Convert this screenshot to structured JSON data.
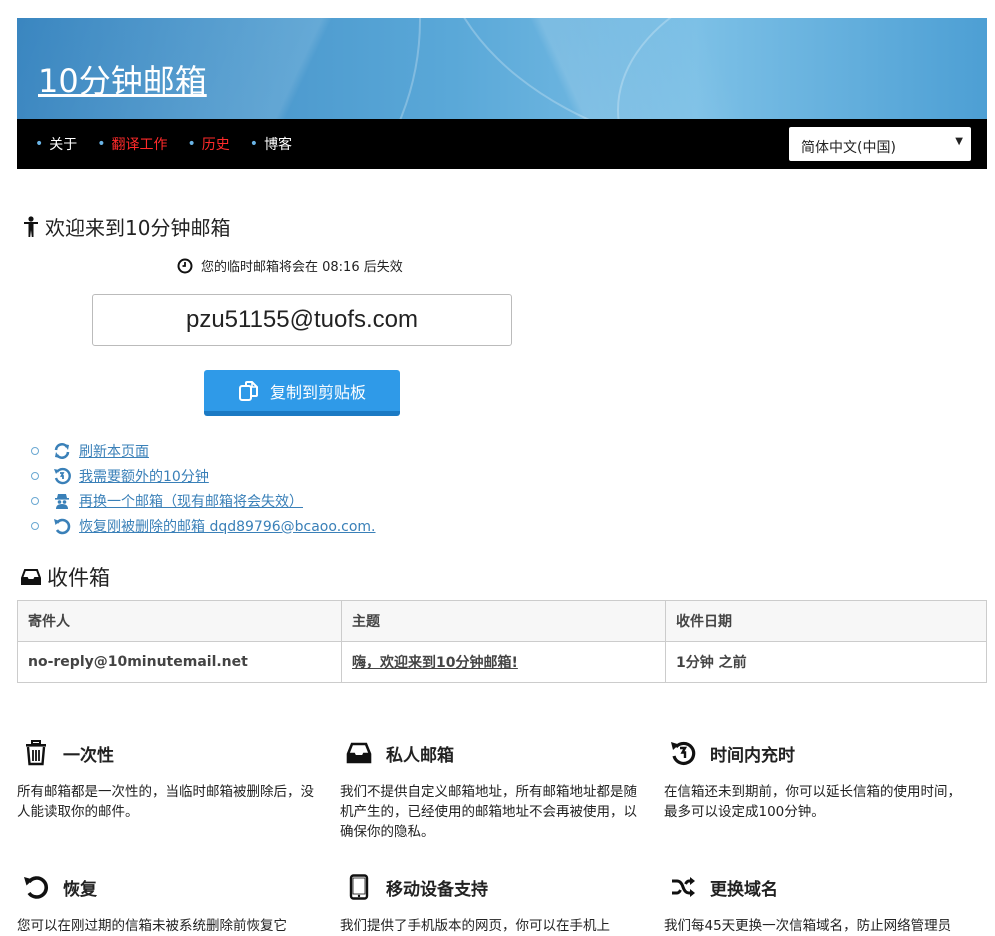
{
  "banner": {
    "title": "10分钟邮箱"
  },
  "nav": {
    "items": [
      {
        "label": "关于",
        "color": "#ffffff"
      },
      {
        "label": "翻译工作",
        "color": "#ff2a2a"
      },
      {
        "label": "历史",
        "color": "#ff2a2a"
      },
      {
        "label": "博客",
        "color": "#ffffff"
      }
    ],
    "language": "简体中文(中国)"
  },
  "welcome": "欢迎来到10分钟邮箱",
  "expire_text": "您的临时邮箱将会在 08:16 后失效",
  "email": "pzu51155@tuofs.com",
  "copy_button": "复制到剪贴板",
  "actions": [
    {
      "icon": "refresh-icon",
      "label": "刷新本页面"
    },
    {
      "icon": "history-plus-icon",
      "label": "我需要额外的10分钟"
    },
    {
      "icon": "spy-icon",
      "label": "再换一个邮箱（现有邮箱将会失效）"
    },
    {
      "icon": "undo-icon",
      "label": "恢复刚被删除的邮箱 dqd89796@bcaoo.com."
    }
  ],
  "inbox": {
    "title": "收件箱",
    "headers": [
      "寄件人",
      "主题",
      "收件日期"
    ],
    "rows": [
      {
        "from": "no-reply@10minutemail.net",
        "subject": "嗨，欢迎来到10分钟邮箱!",
        "date": "1分钟 之前"
      }
    ]
  },
  "features": [
    {
      "icon": "trash-icon",
      "title": "一次性",
      "desc": "所有邮箱都是一次性的，当临时邮箱被删除后，没人能读取你的邮件。"
    },
    {
      "icon": "inbox-icon",
      "title": "私人邮箱",
      "desc": "我们不提供自定义邮箱地址，所有邮箱地址都是随机产生的，已经使用的邮箱地址不会再被使用，以确保你的隐私。"
    },
    {
      "icon": "clock-icon",
      "title": "时间内充时",
      "desc": "在信箱还未到期前，你可以延长信箱的使用时间，最多可以设定成100分钟。"
    },
    {
      "icon": "undo-icon",
      "title": "恢复",
      "desc": "您可以在刚过期的信箱未被系统删除前恢复它"
    },
    {
      "icon": "mobile-icon",
      "title": "移动设备支持",
      "desc": "我们提供了手机版本的网页，你可以在手机上"
    },
    {
      "icon": "shuffle-icon",
      "title": "更换域名",
      "desc": "我们每45天更换一次信箱域名，防止网络管理员"
    }
  ]
}
